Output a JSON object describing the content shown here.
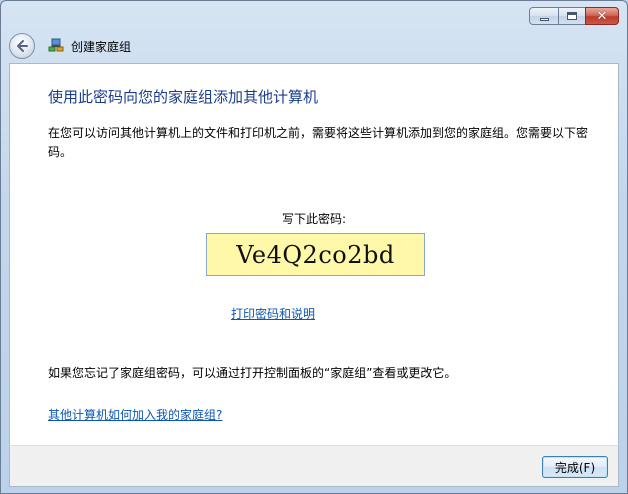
{
  "window": {
    "title": "创建家庭组"
  },
  "page": {
    "heading": "使用此密码向您的家庭组添加其他计算机",
    "description": "在您可以访问其他计算机上的文件和打印机之前，需要将这些计算机添加到您的家庭组。您需要以下密码。",
    "password_label": "写下此密码:",
    "password": "Ve4Q2co2bd",
    "print_link": "打印密码和说明",
    "forgot_text": "如果您忘记了家庭组密码，可以通过打开控制面板的“家庭组”查看或更改它。",
    "join_link": "其他计算机如何加入我的家庭组?"
  },
  "footer": {
    "finish_label": "完成(F)"
  },
  "icons": {
    "back": "back-arrow-icon",
    "homegroup": "homegroup-network-icon",
    "minimize": "minimize-icon",
    "maximize": "maximize-icon",
    "close": "close-icon"
  },
  "colors": {
    "heading": "#1b3d8c",
    "link": "#0d56b3",
    "password_bg": "#fff8a8",
    "close_button": "#c9584a"
  }
}
